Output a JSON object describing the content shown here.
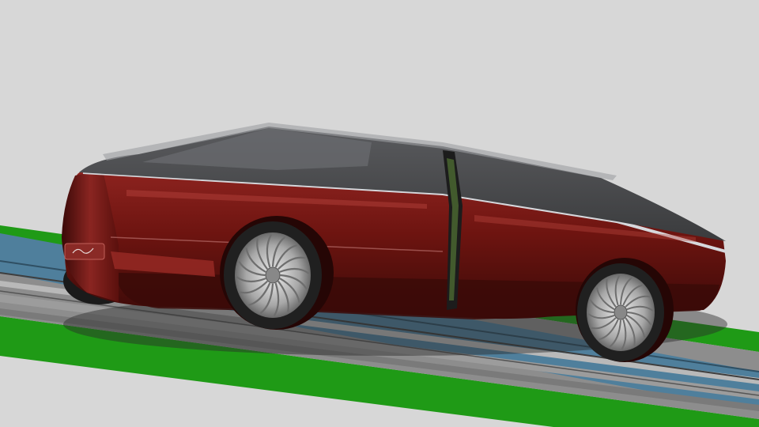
{
  "scene": {
    "subject": "concept-car-render",
    "colors": {
      "background": "#d7d7d7",
      "ground_green": "#1f9a16",
      "road_gray": "#8d8d8d",
      "road_light": "#b9b9b9",
      "water_blue": "#4f7f9c",
      "body_red": "#6d1410",
      "body_red_light": "#9a2b26",
      "roof_gray": "#4a4b4d",
      "chrome": "#d6d8dc",
      "tire": "#202020"
    }
  }
}
